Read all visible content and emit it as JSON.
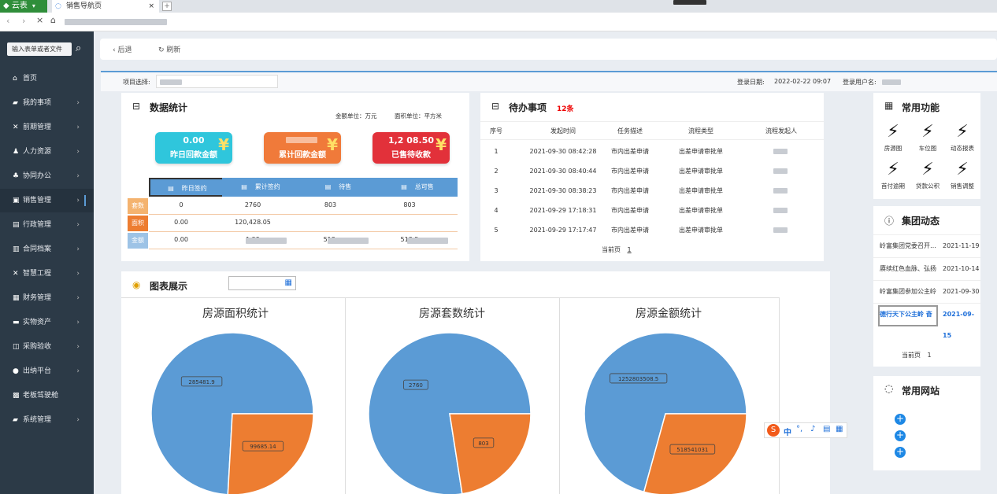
{
  "browser": {
    "app_name": "云表",
    "tab_title": "销售导航页",
    "tab_close": "×",
    "new_tab": "+"
  },
  "sidebar": {
    "search_placeholder": "输入表单或者文件",
    "items": [
      {
        "label": "首页",
        "icon": "home-icon",
        "glyph": "⌂"
      },
      {
        "label": "我的事项",
        "icon": "folder-icon",
        "glyph": "▰"
      },
      {
        "label": "前期管理",
        "icon": "tools-icon",
        "glyph": "✕"
      },
      {
        "label": "人力资源",
        "icon": "users-icon",
        "glyph": "♟"
      },
      {
        "label": "协同办公",
        "icon": "network-icon",
        "glyph": "♣"
      },
      {
        "label": "销售管理",
        "icon": "sales-icon",
        "glyph": "▣"
      },
      {
        "label": "行政管理",
        "icon": "printer-icon",
        "glyph": "▤"
      },
      {
        "label": "合同档案",
        "icon": "contract-icon",
        "glyph": "▥"
      },
      {
        "label": "智慧工程",
        "icon": "engineering-icon",
        "glyph": "✕"
      },
      {
        "label": "财务管理",
        "icon": "finance-icon",
        "glyph": "▦"
      },
      {
        "label": "实物资产",
        "icon": "assets-icon",
        "glyph": "▬"
      },
      {
        "label": "采购验收",
        "icon": "purchase-icon",
        "glyph": "◫"
      },
      {
        "label": "出纳平台",
        "icon": "cashier-icon",
        "glyph": "●"
      },
      {
        "label": "老板驾驶舱",
        "icon": "dashboard-icon",
        "glyph": "▩"
      },
      {
        "label": "系统管理",
        "icon": "system-icon",
        "glyph": "▰"
      }
    ]
  },
  "topnav": {
    "back": "后退",
    "refresh": "刷新"
  },
  "infobar": {
    "project_label": "项目选择:",
    "login_date_label": "登录日期:",
    "login_date": "2022-02-22 09:07",
    "login_user_label": "登录用户名:"
  },
  "stats": {
    "title": "数据统计",
    "amount_unit": "金额单位：万元",
    "area_unit": "面积单位：平方米",
    "cards": [
      {
        "value": "0.00",
        "label": "昨日回款金额",
        "color": "#2fc6dc"
      },
      {
        "value": "",
        "label": "累计回款金额",
        "color": "#f07a3a"
      },
      {
        "value": "1,2    08.50",
        "label": "已售待收款",
        "color": "#e2313a"
      }
    ],
    "headers": [
      "昨日签约",
      "累计签约",
      "待售",
      "总可售"
    ],
    "rows": [
      {
        "label": "套数",
        "values": [
          "0",
          "2760",
          "803",
          "803"
        ]
      },
      {
        "label": "面积",
        "values": [
          "0.00",
          "120,428.05",
          "",
          ""
        ]
      },
      {
        "label": "金额",
        "values": [
          "0.00",
          "1,25",
          "518,",
          "518,5"
        ]
      }
    ]
  },
  "todo": {
    "title": "待办事项",
    "count": "12条",
    "headers": [
      "序号",
      "发起时间",
      "任务描述",
      "流程类型",
      "流程发起人"
    ],
    "rows": [
      [
        "1",
        "2021-09-30 08:42:28",
        "市内出差申请",
        "出差申请审批单"
      ],
      [
        "2",
        "2021-09-30 08:40:44",
        "市内出差申请",
        "出差申请审批单"
      ],
      [
        "3",
        "2021-09-30 08:38:23",
        "市内出差申请",
        "出差申请审批单"
      ],
      [
        "4",
        "2021-09-29 17:18:31",
        "市内出差申请",
        "出差申请审批单"
      ],
      [
        "5",
        "2021-09-29 17:17:47",
        "市内出差申请",
        "出差申请审批单"
      ]
    ],
    "pager_label": "当前页",
    "pager_page": "1"
  },
  "charts_panel": {
    "title": "图表展示"
  },
  "chart_data": [
    {
      "type": "pie",
      "title": "房源面积统计",
      "values": [
        285481.9,
        99685.14
      ],
      "labels": [
        "285481.9",
        "99685.14"
      ],
      "colors": [
        "#5b9bd5",
        "#ed7d31"
      ]
    },
    {
      "type": "pie",
      "title": "房源套数统计",
      "values": [
        2760,
        803
      ],
      "labels": [
        "2760",
        "803"
      ],
      "colors": [
        "#5b9bd5",
        "#ed7d31"
      ]
    },
    {
      "type": "pie",
      "title": "房源金额统计",
      "values": [
        1252803508.5,
        518541031
      ],
      "labels": [
        "1252803508.5",
        "518541031"
      ],
      "colors": [
        "#5b9bd5",
        "#ed7d31"
      ]
    }
  ],
  "functions": {
    "title": "常用功能",
    "items": [
      "房源图",
      "车位图",
      "动态报表",
      "首付逾期",
      "贷款公积",
      "销售调整"
    ]
  },
  "news": {
    "title": "集团动态",
    "items": [
      {
        "text": "岭富集团党委召开…",
        "date": "2021-11-19"
      },
      {
        "text": "赓续红色血脉、弘扬",
        "date": "2021-10-14"
      },
      {
        "text": "岭富集团参加公主岭",
        "date": "2021-09-30"
      },
      {
        "text": "德行天下公主岭 奋",
        "date": "2021-09-15"
      }
    ],
    "pager_label": "当前页",
    "pager_page": "1"
  },
  "websites": {
    "title": "常用网站"
  },
  "ime": {
    "label": "中"
  }
}
